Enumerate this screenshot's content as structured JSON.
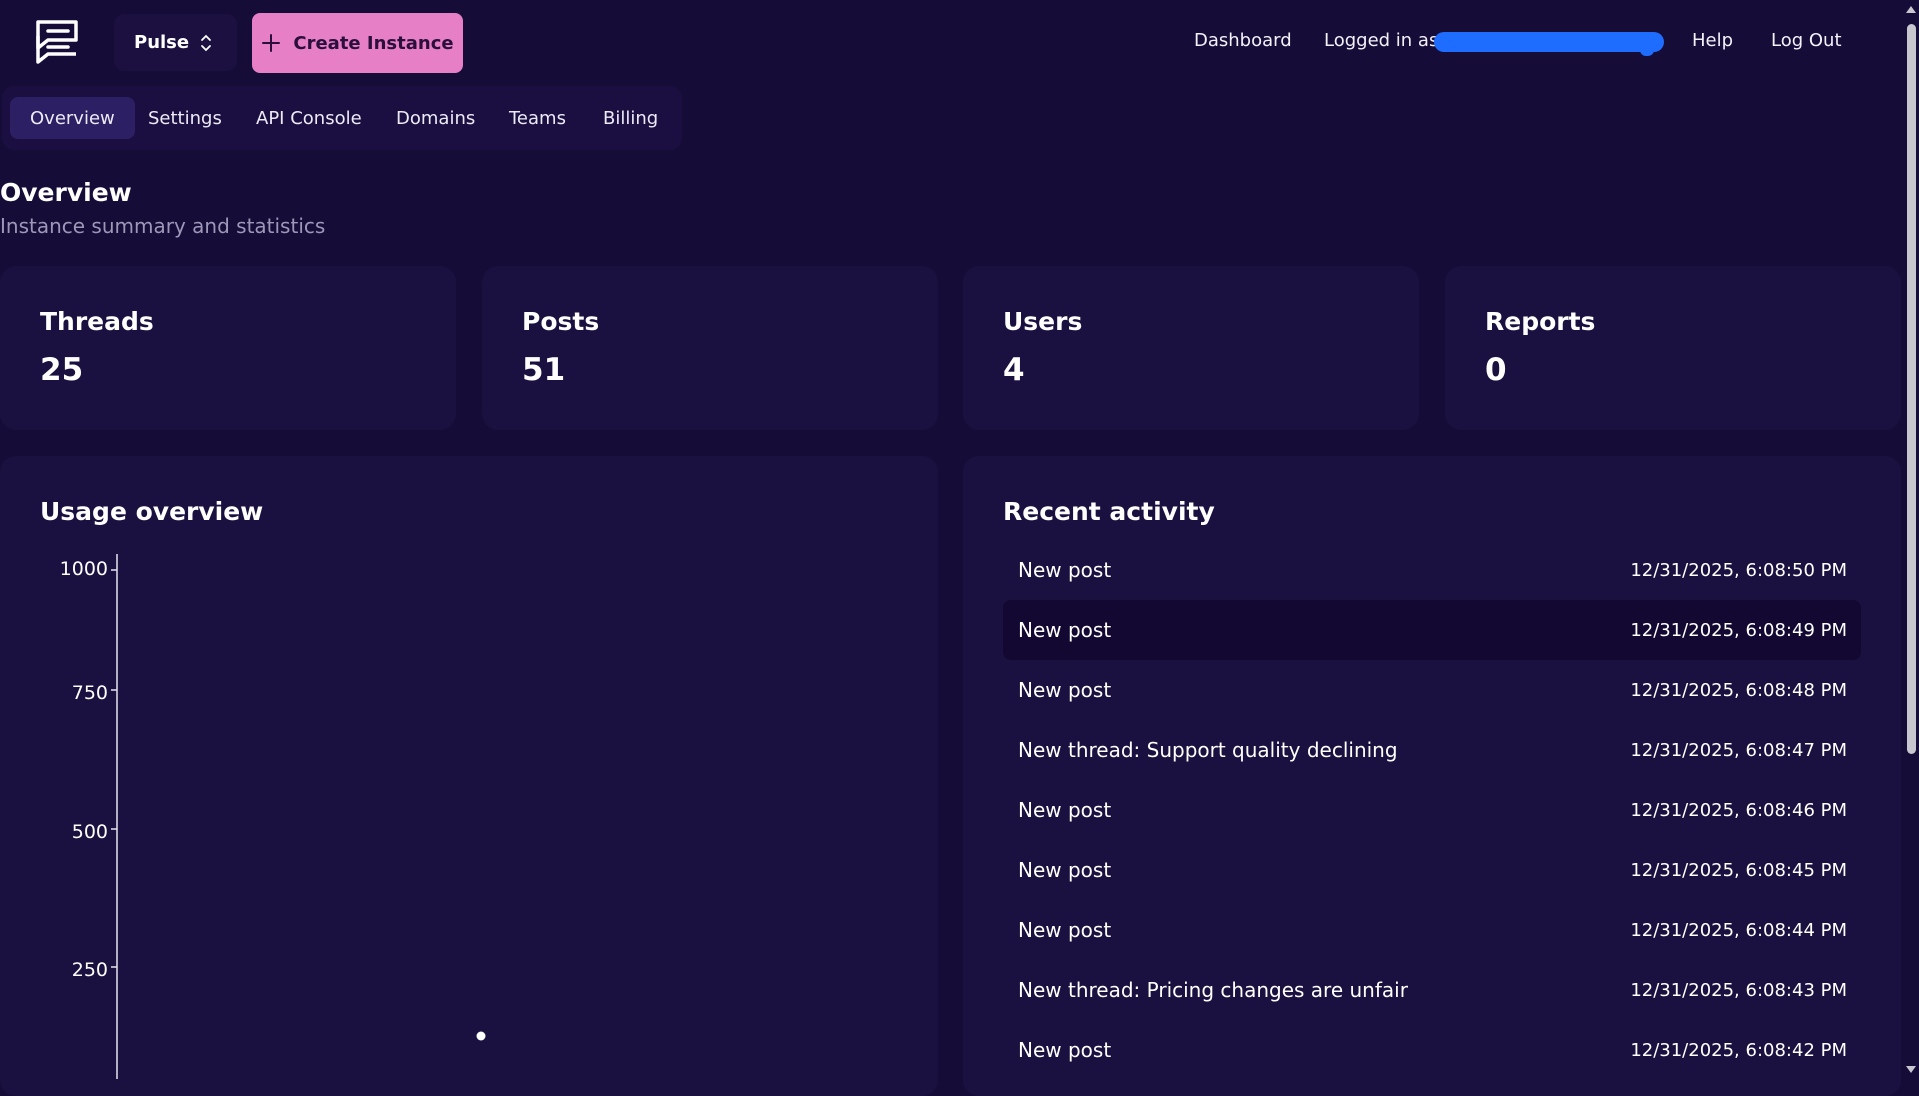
{
  "header": {
    "instance_name": "Pulse",
    "create_button_label": "Create Instance",
    "nav_dashboard": "Dashboard",
    "logged_in_prefix": "Logged in as",
    "nav_help": "Help",
    "nav_logout": "Log Out"
  },
  "tabs": [
    {
      "label": "Overview",
      "active": true
    },
    {
      "label": "Settings",
      "active": false
    },
    {
      "label": "API Console",
      "active": false
    },
    {
      "label": "Domains",
      "active": false
    },
    {
      "label": "Teams",
      "active": false
    },
    {
      "label": "Billing",
      "active": false
    }
  ],
  "page": {
    "title": "Overview",
    "subtitle": "Instance summary and statistics"
  },
  "stats": [
    {
      "label": "Threads",
      "value": "25"
    },
    {
      "label": "Posts",
      "value": "51"
    },
    {
      "label": "Users",
      "value": "4"
    },
    {
      "label": "Reports",
      "value": "0"
    }
  ],
  "usage": {
    "title": "Usage overview",
    "y_ticks": [
      "1000",
      "750",
      "500",
      "250"
    ]
  },
  "chart_data": {
    "type": "scatter",
    "title": "Usage overview",
    "y_ticks": [
      1000,
      750,
      500,
      250
    ],
    "ylim": [
      0,
      1000
    ],
    "grid": false,
    "points": [
      {
        "x_index": 0,
        "y": 51
      }
    ]
  },
  "activity": {
    "title": "Recent activity",
    "items": [
      {
        "text": "New post",
        "time": "12/31/2025, 6:08:50 PM"
      },
      {
        "text": "New post",
        "time": "12/31/2025, 6:08:49 PM"
      },
      {
        "text": "New post",
        "time": "12/31/2025, 6:08:48 PM"
      },
      {
        "text": "New thread: Support quality declining",
        "time": "12/31/2025, 6:08:47 PM"
      },
      {
        "text": "New post",
        "time": "12/31/2025, 6:08:46 PM"
      },
      {
        "text": "New post",
        "time": "12/31/2025, 6:08:45 PM"
      },
      {
        "text": "New post",
        "time": "12/31/2025, 6:08:44 PM"
      },
      {
        "text": "New thread: Pricing changes are unfair",
        "time": "12/31/2025, 6:08:43 PM"
      },
      {
        "text": "New post",
        "time": "12/31/2025, 6:08:42 PM"
      }
    ]
  },
  "colors": {
    "background": "#160c38",
    "card": "#1b1140",
    "accent_button": "#e77fc6",
    "active_tab": "#2c1f64"
  }
}
